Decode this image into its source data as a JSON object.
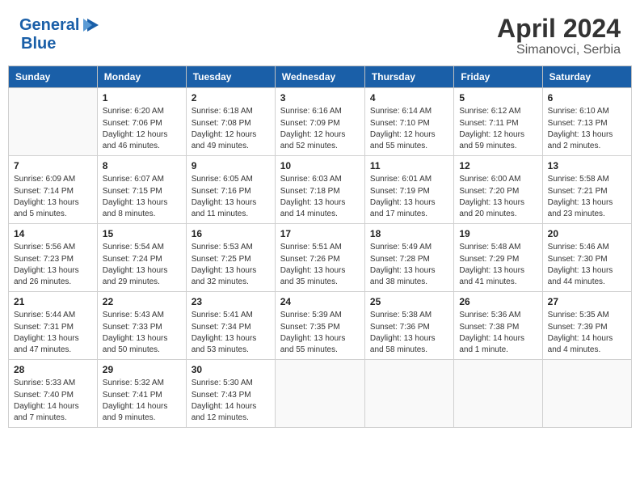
{
  "header": {
    "logo_line1": "General",
    "logo_line2": "Blue",
    "month": "April 2024",
    "location": "Simanovci, Serbia"
  },
  "weekdays": [
    "Sunday",
    "Monday",
    "Tuesday",
    "Wednesday",
    "Thursday",
    "Friday",
    "Saturday"
  ],
  "weeks": [
    [
      {
        "day": "",
        "sunrise": "",
        "sunset": "",
        "daylight": ""
      },
      {
        "day": "1",
        "sunrise": "Sunrise: 6:20 AM",
        "sunset": "Sunset: 7:06 PM",
        "daylight": "Daylight: 12 hours and 46 minutes."
      },
      {
        "day": "2",
        "sunrise": "Sunrise: 6:18 AM",
        "sunset": "Sunset: 7:08 PM",
        "daylight": "Daylight: 12 hours and 49 minutes."
      },
      {
        "day": "3",
        "sunrise": "Sunrise: 6:16 AM",
        "sunset": "Sunset: 7:09 PM",
        "daylight": "Daylight: 12 hours and 52 minutes."
      },
      {
        "day": "4",
        "sunrise": "Sunrise: 6:14 AM",
        "sunset": "Sunset: 7:10 PM",
        "daylight": "Daylight: 12 hours and 55 minutes."
      },
      {
        "day": "5",
        "sunrise": "Sunrise: 6:12 AM",
        "sunset": "Sunset: 7:11 PM",
        "daylight": "Daylight: 12 hours and 59 minutes."
      },
      {
        "day": "6",
        "sunrise": "Sunrise: 6:10 AM",
        "sunset": "Sunset: 7:13 PM",
        "daylight": "Daylight: 13 hours and 2 minutes."
      }
    ],
    [
      {
        "day": "7",
        "sunrise": "Sunrise: 6:09 AM",
        "sunset": "Sunset: 7:14 PM",
        "daylight": "Daylight: 13 hours and 5 minutes."
      },
      {
        "day": "8",
        "sunrise": "Sunrise: 6:07 AM",
        "sunset": "Sunset: 7:15 PM",
        "daylight": "Daylight: 13 hours and 8 minutes."
      },
      {
        "day": "9",
        "sunrise": "Sunrise: 6:05 AM",
        "sunset": "Sunset: 7:16 PM",
        "daylight": "Daylight: 13 hours and 11 minutes."
      },
      {
        "day": "10",
        "sunrise": "Sunrise: 6:03 AM",
        "sunset": "Sunset: 7:18 PM",
        "daylight": "Daylight: 13 hours and 14 minutes."
      },
      {
        "day": "11",
        "sunrise": "Sunrise: 6:01 AM",
        "sunset": "Sunset: 7:19 PM",
        "daylight": "Daylight: 13 hours and 17 minutes."
      },
      {
        "day": "12",
        "sunrise": "Sunrise: 6:00 AM",
        "sunset": "Sunset: 7:20 PM",
        "daylight": "Daylight: 13 hours and 20 minutes."
      },
      {
        "day": "13",
        "sunrise": "Sunrise: 5:58 AM",
        "sunset": "Sunset: 7:21 PM",
        "daylight": "Daylight: 13 hours and 23 minutes."
      }
    ],
    [
      {
        "day": "14",
        "sunrise": "Sunrise: 5:56 AM",
        "sunset": "Sunset: 7:23 PM",
        "daylight": "Daylight: 13 hours and 26 minutes."
      },
      {
        "day": "15",
        "sunrise": "Sunrise: 5:54 AM",
        "sunset": "Sunset: 7:24 PM",
        "daylight": "Daylight: 13 hours and 29 minutes."
      },
      {
        "day": "16",
        "sunrise": "Sunrise: 5:53 AM",
        "sunset": "Sunset: 7:25 PM",
        "daylight": "Daylight: 13 hours and 32 minutes."
      },
      {
        "day": "17",
        "sunrise": "Sunrise: 5:51 AM",
        "sunset": "Sunset: 7:26 PM",
        "daylight": "Daylight: 13 hours and 35 minutes."
      },
      {
        "day": "18",
        "sunrise": "Sunrise: 5:49 AM",
        "sunset": "Sunset: 7:28 PM",
        "daylight": "Daylight: 13 hours and 38 minutes."
      },
      {
        "day": "19",
        "sunrise": "Sunrise: 5:48 AM",
        "sunset": "Sunset: 7:29 PM",
        "daylight": "Daylight: 13 hours and 41 minutes."
      },
      {
        "day": "20",
        "sunrise": "Sunrise: 5:46 AM",
        "sunset": "Sunset: 7:30 PM",
        "daylight": "Daylight: 13 hours and 44 minutes."
      }
    ],
    [
      {
        "day": "21",
        "sunrise": "Sunrise: 5:44 AM",
        "sunset": "Sunset: 7:31 PM",
        "daylight": "Daylight: 13 hours and 47 minutes."
      },
      {
        "day": "22",
        "sunrise": "Sunrise: 5:43 AM",
        "sunset": "Sunset: 7:33 PM",
        "daylight": "Daylight: 13 hours and 50 minutes."
      },
      {
        "day": "23",
        "sunrise": "Sunrise: 5:41 AM",
        "sunset": "Sunset: 7:34 PM",
        "daylight": "Daylight: 13 hours and 53 minutes."
      },
      {
        "day": "24",
        "sunrise": "Sunrise: 5:39 AM",
        "sunset": "Sunset: 7:35 PM",
        "daylight": "Daylight: 13 hours and 55 minutes."
      },
      {
        "day": "25",
        "sunrise": "Sunrise: 5:38 AM",
        "sunset": "Sunset: 7:36 PM",
        "daylight": "Daylight: 13 hours and 58 minutes."
      },
      {
        "day": "26",
        "sunrise": "Sunrise: 5:36 AM",
        "sunset": "Sunset: 7:38 PM",
        "daylight": "Daylight: 14 hours and 1 minute."
      },
      {
        "day": "27",
        "sunrise": "Sunrise: 5:35 AM",
        "sunset": "Sunset: 7:39 PM",
        "daylight": "Daylight: 14 hours and 4 minutes."
      }
    ],
    [
      {
        "day": "28",
        "sunrise": "Sunrise: 5:33 AM",
        "sunset": "Sunset: 7:40 PM",
        "daylight": "Daylight: 14 hours and 7 minutes."
      },
      {
        "day": "29",
        "sunrise": "Sunrise: 5:32 AM",
        "sunset": "Sunset: 7:41 PM",
        "daylight": "Daylight: 14 hours and 9 minutes."
      },
      {
        "day": "30",
        "sunrise": "Sunrise: 5:30 AM",
        "sunset": "Sunset: 7:43 PM",
        "daylight": "Daylight: 14 hours and 12 minutes."
      },
      {
        "day": "",
        "sunrise": "",
        "sunset": "",
        "daylight": ""
      },
      {
        "day": "",
        "sunrise": "",
        "sunset": "",
        "daylight": ""
      },
      {
        "day": "",
        "sunrise": "",
        "sunset": "",
        "daylight": ""
      },
      {
        "day": "",
        "sunrise": "",
        "sunset": "",
        "daylight": ""
      }
    ]
  ]
}
